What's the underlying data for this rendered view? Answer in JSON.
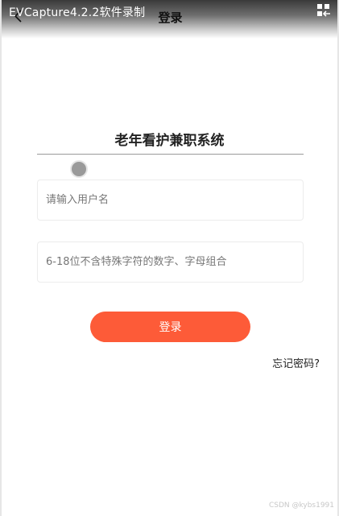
{
  "header": {
    "recorder_watermark": "EVCapture4.2.2软件录制",
    "title": "登录",
    "back_icon": "chevron-left-icon",
    "menu_icon": "grid-exit-icon"
  },
  "main": {
    "app_title": "老年看护兼职系统",
    "username": {
      "value": "",
      "placeholder": "请输入用户名"
    },
    "password": {
      "value": "",
      "placeholder": "6-18位不含特殊字符的数字、字母组合"
    },
    "login_button_label": "登录",
    "forgot_password_label": "忘记密码?",
    "accent_color": "#fd5b38"
  },
  "footer": {
    "watermark": "CSDN @kybs1991"
  }
}
